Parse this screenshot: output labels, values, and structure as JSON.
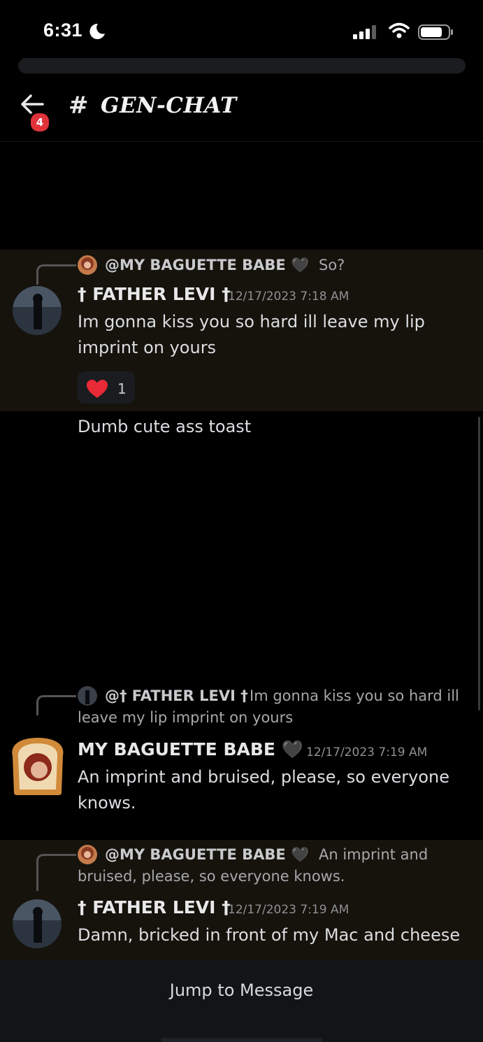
{
  "status_bar": {
    "time": "6:31"
  },
  "header": {
    "channel": "GEN-CHAT",
    "notification_count": "4"
  },
  "messages": [
    {
      "reply_to": {
        "name": "@MY BAGUETTE BABE 🖤",
        "text": "So?"
      },
      "author": "† FATHER LEVI †",
      "timestamp": "12/17/2023 7:18 AM",
      "lines": [
        "Im gonna kiss you so hard ill leave my lip",
        "imprint on yours"
      ],
      "reaction": {
        "emoji": "❤️",
        "count": "1"
      }
    },
    {
      "text": "Dumb cute ass toast"
    },
    {
      "reply_to": {
        "name": "@† FATHER LEVI †",
        "text_line1": "Im gonna kiss you so hard ill",
        "text_line2": "leave my lip imprint on yours"
      },
      "author": "MY BAGUETTE BABE 🖤",
      "timestamp": "12/17/2023 7:19 AM",
      "lines": [
        "An imprint and bruised, please, so everyone",
        "knows."
      ]
    },
    {
      "reply_to": {
        "name": "@MY BAGUETTE BABE 🖤",
        "text_line1": "An imprint and",
        "text_line2": "bruised, please, so everyone knows."
      },
      "author": "† FATHER LEVI †",
      "timestamp": "12/17/2023 7:19 AM",
      "lines": [
        "Damn, bricked in front of my Mac and cheese"
      ]
    }
  ],
  "jump_button": "Jump to Message",
  "icons": {
    "back": "back-arrow-icon",
    "moon": "moon-icon",
    "signal": "signal-icon",
    "wifi": "wifi-icon",
    "battery": "battery-icon"
  }
}
